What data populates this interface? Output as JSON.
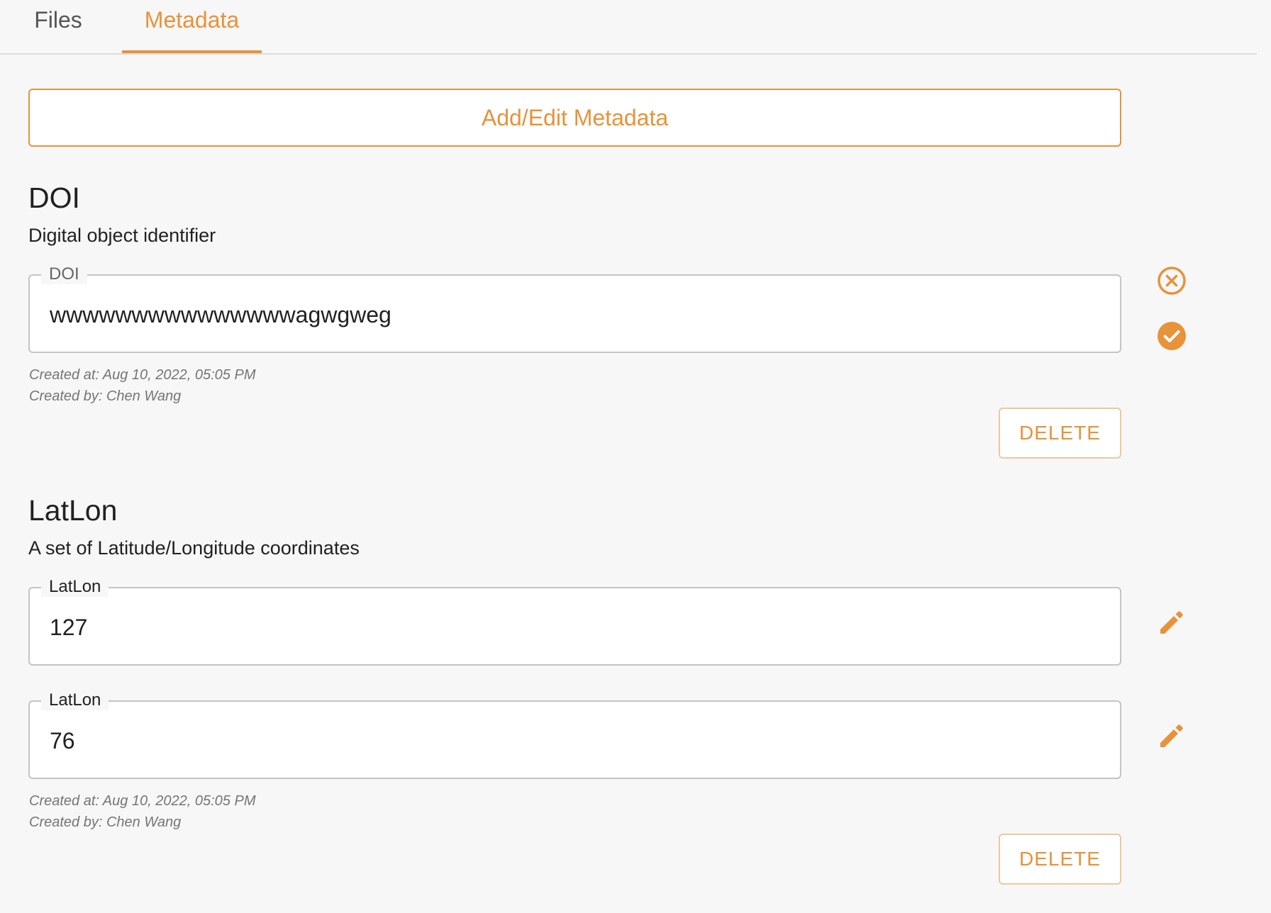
{
  "tabs": [
    {
      "label": "Files",
      "active": false
    },
    {
      "label": "Metadata",
      "active": true
    }
  ],
  "add_button": {
    "label": "Add/Edit Metadata"
  },
  "sections": [
    {
      "title": "DOI",
      "description": "Digital object identifier",
      "fields": [
        {
          "label": "DOI",
          "value": "wwwwwwwwwwwwwwwagwgweg",
          "mode": "editing",
          "icons": [
            "cancel-circle-icon",
            "check-circle-icon"
          ]
        }
      ],
      "created_at": "Created at: Aug 10, 2022, 05:05 PM",
      "created_by": "Created by: Chen Wang",
      "delete_label": "DELETE"
    },
    {
      "title": "LatLon",
      "description": "A set of Latitude/Longitude coordinates",
      "fields": [
        {
          "label": "LatLon",
          "value": "127",
          "mode": "view",
          "icons": [
            "pencil-icon"
          ]
        },
        {
          "label": "LatLon",
          "value": "76",
          "mode": "view",
          "icons": [
            "pencil-icon"
          ]
        }
      ],
      "created_at": "Created at: Aug 10, 2022, 05:05 PM",
      "created_by": "Created by: Chen Wang",
      "delete_label": "DELETE"
    }
  ],
  "colors": {
    "accent": "#e8923a",
    "background": "#f7f7f7",
    "field_border": "#c4c4c4",
    "meta_text": "#757575"
  }
}
